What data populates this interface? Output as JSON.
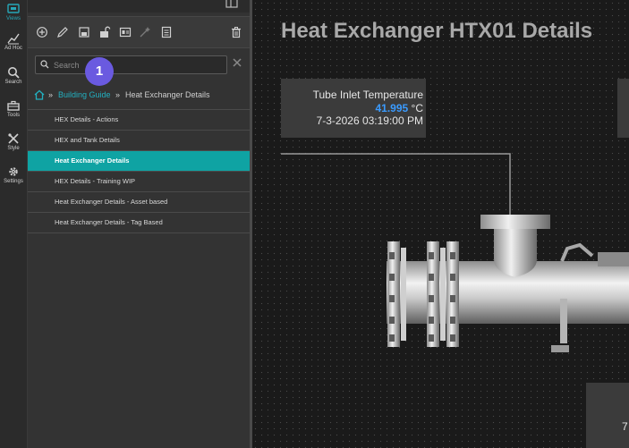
{
  "rail": {
    "items": [
      {
        "label": "Views",
        "icon": "views-icon",
        "active": true
      },
      {
        "label": "Ad Hoc",
        "icon": "chart-line-icon"
      },
      {
        "label": "Search",
        "icon": "search-icon"
      },
      {
        "label": "Tools",
        "icon": "toolbox-icon"
      },
      {
        "label": "Style",
        "icon": "brush-icon"
      },
      {
        "label": "Settings",
        "icon": "gear-icon"
      }
    ]
  },
  "toolbar": {
    "buttons": [
      "add-icon",
      "edit-icon",
      "save-icon",
      "unlock-icon",
      "id-card-icon",
      "magic-wand-icon",
      "document-icon",
      "trash-icon"
    ]
  },
  "search": {
    "placeholder": "Search",
    "badge": "1"
  },
  "breadcrumb": {
    "root_link": "Building Guide",
    "current": "Heat Exchanger Details",
    "separator": "»"
  },
  "nav": {
    "items": [
      {
        "label": "HEX Details - Actions"
      },
      {
        "label": "HEX and Tank Details"
      },
      {
        "label": "Heat Exchanger Details",
        "active": true
      },
      {
        "label": "HEX Details - Training WIP"
      },
      {
        "label": "Heat Exchanger Details - Asset based"
      },
      {
        "label": "Heat Exchanger Details - Tag Based"
      }
    ]
  },
  "canvas": {
    "title": "Heat Exchanger HTX01 Details",
    "tube_inlet": {
      "label": "Tube Inlet Temperature",
      "value": "41.995",
      "unit": "°C",
      "timestamp": "7-3-2026 03:19:00 PM"
    },
    "bottom_card_text": "7"
  },
  "colors": {
    "accent": "#0fa3a3",
    "link": "#22b0c0",
    "value": "#3a9bff",
    "badge": "#6a5ae0"
  }
}
